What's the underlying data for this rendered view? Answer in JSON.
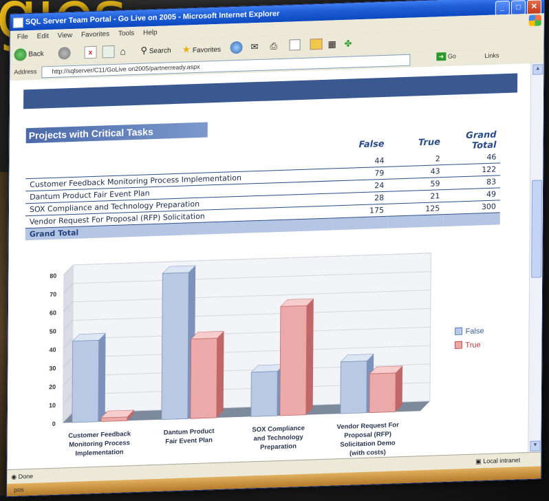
{
  "background": {
    "word": "gies",
    "word_color": "#e8b81a"
  },
  "window": {
    "title": "SQL Server Team Portal - Go Live on 2005 - Microsoft Internet Explorer",
    "menu": [
      "File",
      "Edit",
      "View",
      "Favorites",
      "Tools",
      "Help"
    ],
    "toolbar": {
      "back": "Back",
      "search": "Search",
      "favorites": "Favorites"
    },
    "address_label": "Address",
    "address_url": "http://sqlserver/C11/GoLive on2005/partnerready.aspx",
    "go_label": "Go",
    "links_label": "Links",
    "status_text": "Done",
    "status_zone": "Local intranet",
    "taskbar_text": "pos"
  },
  "report": {
    "title": "Projects with Critical Tasks",
    "columns": [
      "False",
      "True",
      "Grand Total"
    ],
    "rows": [
      {
        "label": "",
        "false": "44",
        "true": "2",
        "total": "46"
      },
      {
        "label": "Customer Feedback Monitoring Process Implementation",
        "false": "79",
        "true": "43",
        "total": "122"
      },
      {
        "label": "Dantum Product Fair Event Plan",
        "false": "24",
        "true": "59",
        "total": "83"
      },
      {
        "label": "SOX Compliance and Technology Preparation",
        "false": "28",
        "true": "21",
        "total": "49"
      },
      {
        "label": "Vendor Request For Proposal (RFP) Solicitation",
        "false": "175",
        "true": "125",
        "total": "300"
      }
    ],
    "total_label": "Grand Total"
  },
  "chart_data": {
    "type": "bar",
    "categories": [
      "Customer Feedback Monitoring Process Implementation",
      "Dantum Product Fair Event Plan",
      "SOX Compliance and Technology Preparation",
      "Vendor Request For Proposal (RFP) Solicitation Demo (with costs)"
    ],
    "category_lines": [
      [
        "Customer Feedback",
        "Monitoring Process",
        "Implementation"
      ],
      [
        "Dantum Product",
        "Fair Event Plan"
      ],
      [
        "SOX Compliance",
        "and Technology",
        "Preparation"
      ],
      [
        "Vendor Request For",
        "Proposal (RFP)",
        "Solicitation Demo",
        "(with costs)"
      ]
    ],
    "series": [
      {
        "name": "False",
        "values": [
          44,
          79,
          24,
          28
        ],
        "color": "#b9c9e4"
      },
      {
        "name": "True",
        "values": [
          2,
          43,
          59,
          21
        ],
        "color": "#eba9a9"
      }
    ],
    "yticks": [
      0,
      10,
      20,
      30,
      40,
      50,
      60,
      70,
      80
    ],
    "ylim": [
      0,
      80
    ],
    "grid": true,
    "legend": "right"
  }
}
